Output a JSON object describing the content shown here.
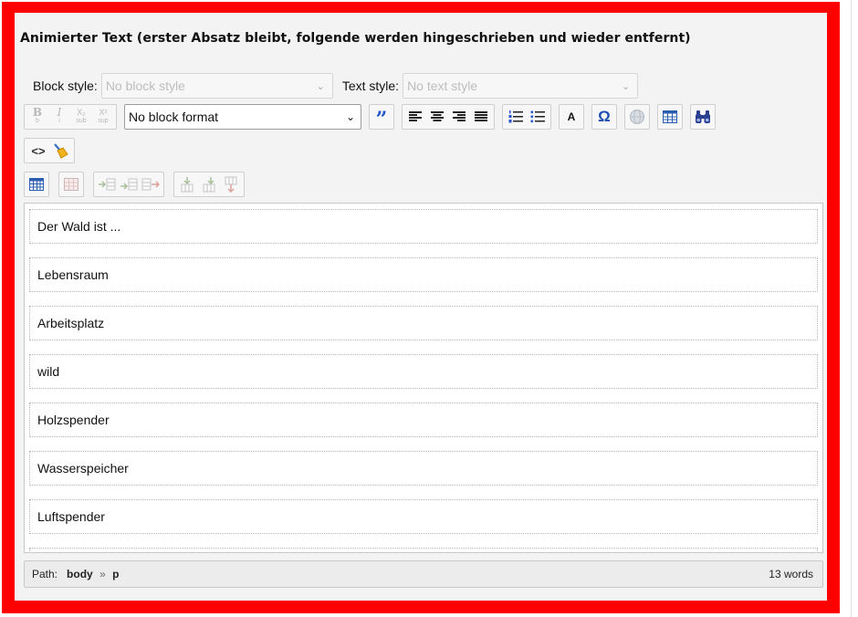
{
  "title": "Animierter Text (erster Absatz bleibt, folgende werden hingeschrieben und wieder entfernt)",
  "block_style": {
    "label": "Block style:",
    "value": "No block style"
  },
  "text_style": {
    "label": "Text style:",
    "value": "No text style"
  },
  "toolbar": {
    "bold": "B",
    "bold_sub": "b",
    "italic": "I",
    "italic_sub": "i",
    "subscript": "X₂",
    "subscript_sub": "sub",
    "superscript": "X²",
    "superscript_sub": "sup",
    "block_format": "No block format",
    "text_color": "A"
  },
  "paragraphs": [
    "Der Wald ist ...",
    "Lebensraum",
    "Arbeitsplatz",
    "wild",
    "Holzspender",
    "Wasserspeicher",
    "Luftspender"
  ],
  "status": {
    "path_label": "Path:",
    "path_body": "body",
    "path_sep": "»",
    "path_p": "p",
    "word_count": "13 words"
  },
  "colors": {
    "frame": "#ff0000",
    "quote": "#2255cc",
    "omega": "#1e4fb0"
  }
}
